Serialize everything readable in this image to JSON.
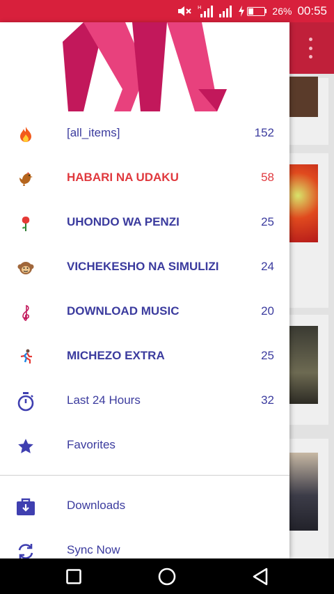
{
  "status_bar": {
    "battery_percent": "26%",
    "time": "00:55",
    "icons": [
      "mute-icon",
      "signal-icon",
      "signal-icon-2",
      "charging-icon",
      "battery-icon"
    ]
  },
  "drawer": {
    "items": [
      {
        "icon": "fire-icon",
        "label": "[all_items]",
        "count": "152",
        "active": false
      },
      {
        "icon": "rooster-icon",
        "label": "HABARI NA UDAKU",
        "count": "58",
        "active": true
      },
      {
        "icon": "rose-icon",
        "label": "UHONDO WA PENZI",
        "count": "25",
        "active": false
      },
      {
        "icon": "monkey-icon",
        "label": "VICHEKESHO NA SIMULIZI",
        "count": "24",
        "active": false
      },
      {
        "icon": "music-clef-icon",
        "label": "DOWNLOAD MUSIC",
        "count": "20",
        "active": false
      },
      {
        "icon": "runner-icon",
        "label": "MICHEZO EXTRA",
        "count": "25",
        "active": false
      },
      {
        "icon": "stopwatch-icon",
        "label": "Last 24 Hours",
        "count": "32",
        "active": false
      },
      {
        "icon": "star-icon",
        "label": "Favorites",
        "count": "",
        "active": false
      }
    ],
    "secondary_items": [
      {
        "icon": "download-box-icon",
        "label": "Downloads"
      },
      {
        "icon": "sync-icon",
        "label": "Sync Now"
      }
    ]
  },
  "colors": {
    "status_bar": "#d8203c",
    "toolbar": "#c0203a",
    "item_text": "#3b3b9e",
    "active_text": "#e0393e",
    "logo_pink": "#e8417d",
    "logo_magenta": "#c2185b"
  }
}
